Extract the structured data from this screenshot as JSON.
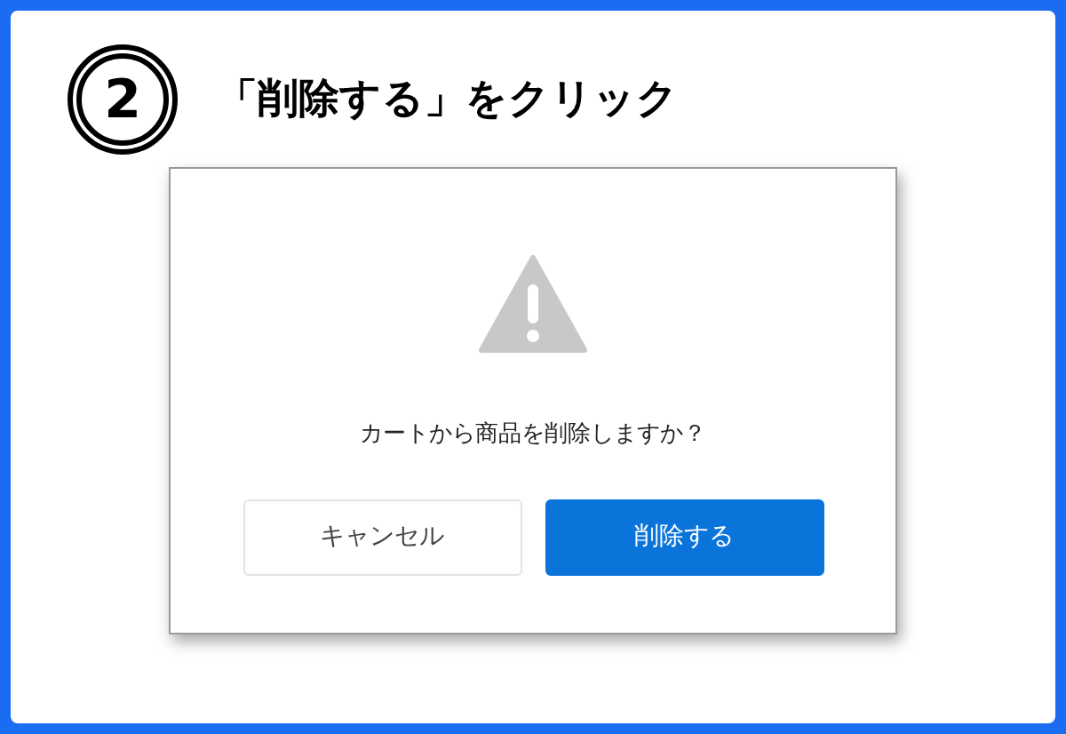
{
  "step": {
    "number": "2",
    "instruction": "「削除する」をクリック"
  },
  "dialog": {
    "message": "カートから商品を削除しますか？",
    "buttons": [
      {
        "label": "キャンセル",
        "kind": "secondary"
      },
      {
        "label": "削除する",
        "kind": "primary"
      }
    ]
  }
}
